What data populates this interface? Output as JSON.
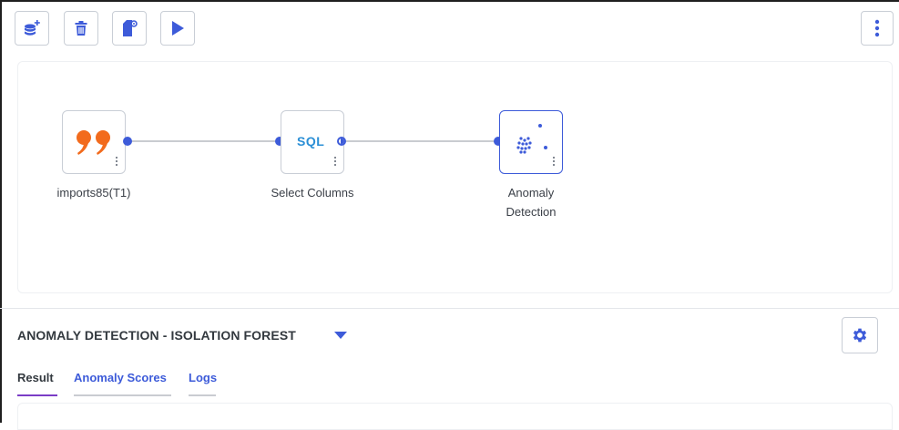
{
  "toolbar": {
    "buttons": [
      {
        "name": "add-dataset-button",
        "icon": "database-plus-icon"
      },
      {
        "name": "delete-button",
        "icon": "trash-icon"
      },
      {
        "name": "node-settings-button",
        "icon": "file-gear-icon"
      },
      {
        "name": "run-button",
        "icon": "play-icon"
      }
    ],
    "more_icon": "vertical-ellipsis-icon"
  },
  "flow": {
    "nodes": [
      {
        "id": "imports85",
        "label": "imports85(T1)",
        "icon": "quote-icon"
      },
      {
        "id": "select-columns",
        "label": "Select Columns",
        "icon_text": "SQL"
      },
      {
        "id": "anomaly-detection",
        "label_line1": "Anomaly",
        "label_line2": "Detection",
        "icon": "scatter-dots-icon",
        "selected": true
      }
    ]
  },
  "panel": {
    "title": "ANOMALY DETECTION - ISOLATION FOREST",
    "tabs": [
      {
        "label": "Result",
        "active": true
      },
      {
        "label": "Anomaly Scores",
        "active": false
      },
      {
        "label": "Logs",
        "active": false
      }
    ]
  },
  "colors": {
    "accent": "#3d5bd9",
    "quote_orange": "#f26b1d",
    "sql_blue": "#2b8fd6",
    "active_tab_underline": "#7a3cc6",
    "inactive_tab_underline": "#c9ccd1",
    "title_text": "#33393f"
  }
}
